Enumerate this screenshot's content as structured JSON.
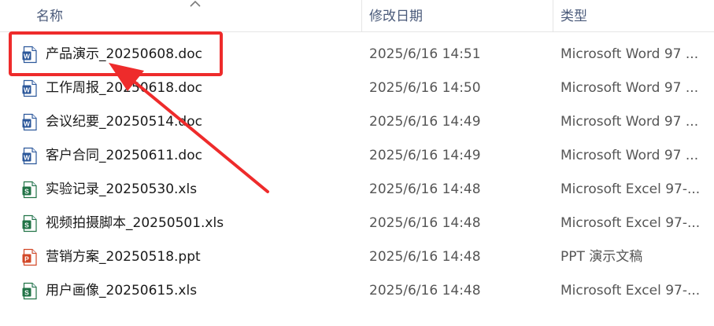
{
  "columns": {
    "name": "名称",
    "date": "修改日期",
    "type": "类型"
  },
  "files": [
    {
      "name": "产品演示_20250608.doc",
      "date": "2025/6/16 14:51",
      "type": "Microsoft Word 97 ...",
      "icon": "word-doc-icon",
      "letter": "W",
      "color": "#2b579a"
    },
    {
      "name": "工作周报_20250618.doc",
      "date": "2025/6/16 14:50",
      "type": "Microsoft Word 97 ...",
      "icon": "word-doc-icon",
      "letter": "W",
      "color": "#2b579a"
    },
    {
      "name": "会议纪要_20250514.doc",
      "date": "2025/6/16 14:49",
      "type": "Microsoft Word 97 ...",
      "icon": "word-doc-icon",
      "letter": "W",
      "color": "#2b579a"
    },
    {
      "name": "客户合同_20250611.doc",
      "date": "2025/6/16 14:49",
      "type": "Microsoft Word 97 ...",
      "icon": "word-doc-icon",
      "letter": "W",
      "color": "#2b579a"
    },
    {
      "name": "实验记录_20250530.xls",
      "date": "2025/6/16 14:48",
      "type": "Microsoft Excel 97-...",
      "icon": "excel-sheet-icon",
      "letter": "S",
      "color": "#217346"
    },
    {
      "name": "视频拍摄脚本_20250501.xls",
      "date": "2025/6/16 14:48",
      "type": "Microsoft Excel 97-...",
      "icon": "excel-sheet-icon",
      "letter": "S",
      "color": "#217346"
    },
    {
      "name": "营销方案_20250518.ppt",
      "date": "2025/6/16 14:48",
      "type": "PPT 演示文稿",
      "icon": "ppt-presentation-icon",
      "letter": "P",
      "color": "#d24726"
    },
    {
      "name": "用户画像_20250615.xls",
      "date": "2025/6/16 14:48",
      "type": "Microsoft Excel 97-...",
      "icon": "excel-sheet-icon",
      "letter": "S",
      "color": "#217346"
    }
  ],
  "annotation": {
    "box_color": "#ee2b2b",
    "arrow_color": "#ee2b2b",
    "target_row": 0
  }
}
